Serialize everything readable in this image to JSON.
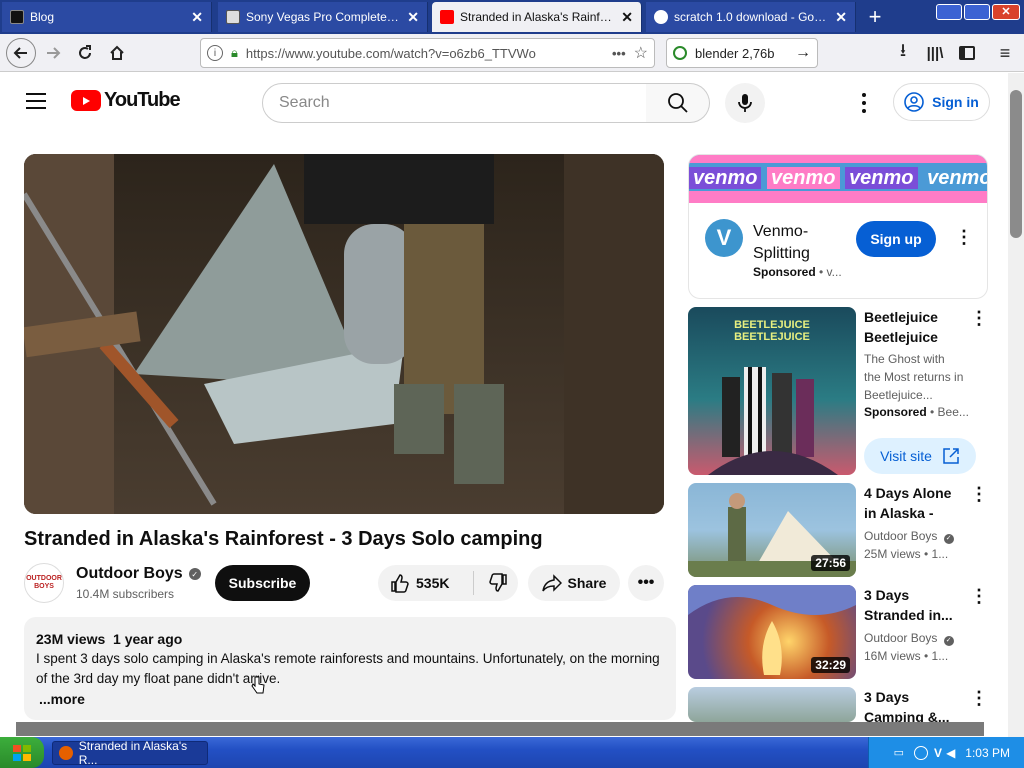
{
  "browser": {
    "tabs": [
      {
        "title": "Blog",
        "active": false
      },
      {
        "title": "Sony Vegas Pro Complete Pack",
        "active": false
      },
      {
        "title": "Stranded in Alaska's Rainforest",
        "active": true
      },
      {
        "title": "scratch 1.0 download - Google S",
        "active": false
      }
    ],
    "url": "https://www.youtube.com/watch?v=o6zb6_TTVWo",
    "search_value": "blender 2,76b"
  },
  "youtube": {
    "logo_text": "YouTube",
    "search_placeholder": "Search",
    "signin_label": "Sign in",
    "video": {
      "title": "Stranded in Alaska's Rainforest - 3 Days Solo camping",
      "channel": "Outdoor Boys",
      "avatar_text": "OUTDOOR BOYS",
      "subscribers": "10.4M subscribers",
      "subscribe_label": "Subscribe",
      "likes": "535K",
      "share_label": "Share",
      "views": "23M views",
      "age": "1 year ago",
      "description": "I spent 3 days solo camping in Alaska's remote rainforests and mountains. Unfortunately, on the morning of the 3rd day my float pane didn't arrive.",
      "more_label": "...more"
    },
    "ad_venmo": {
      "banner_word": "venmo",
      "title": "Venmo-Splitting",
      "sponsored": "Sponsored",
      "source": "v...",
      "cta": "Sign up"
    },
    "ad_beetlejuice": {
      "poster_title": "BEETLEJUICE BEETLEJUICE",
      "title": "Beetlejuice Beetlejuice",
      "desc": "The Ghost with the Most returns in Beetlejuice...",
      "sponsored": "Sponsored",
      "source": "Bee...",
      "cta": "Visit site"
    },
    "recommendations": [
      {
        "title": "4 Days Alone in Alaska -",
        "channel": "Outdoor Boys",
        "meta": "25M views  •  1...",
        "duration": "27:56"
      },
      {
        "title": "3 Days Stranded in...",
        "channel": "Outdoor Boys",
        "meta": "16M views  •  1...",
        "duration": "32:29"
      },
      {
        "title": "3 Days Camping &...",
        "channel": "",
        "meta": "",
        "duration": ""
      }
    ]
  },
  "taskbar": {
    "task_label": "Stranded in Alaska's R...",
    "clock": "1:03 PM"
  },
  "colors": {
    "yt_red": "#ff0000",
    "subscribe_bg": "#0f0f0f",
    "link_blue": "#065fd4",
    "venmo_blue": "#3d95ce"
  }
}
